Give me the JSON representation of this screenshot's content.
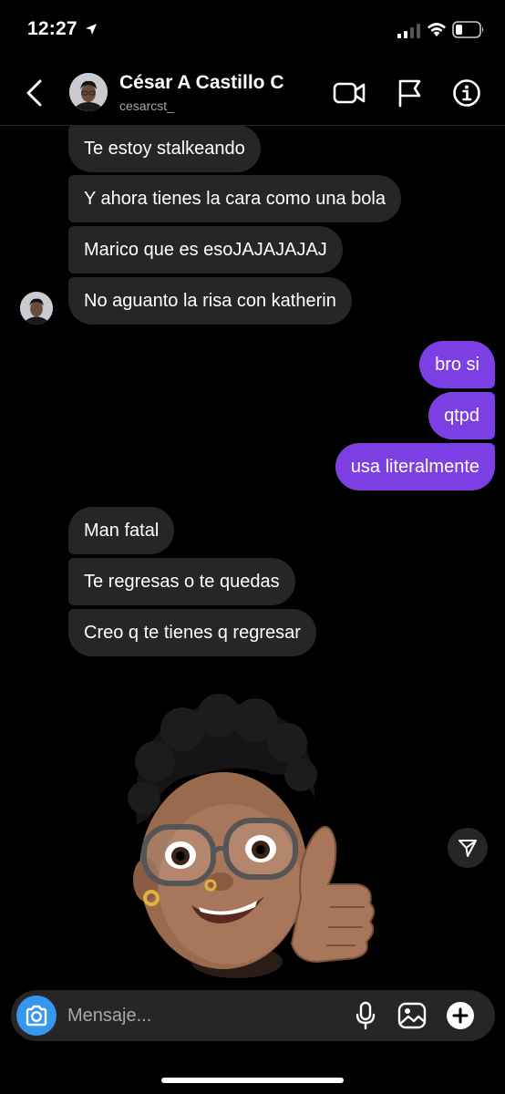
{
  "status_bar": {
    "time": "12:27"
  },
  "header": {
    "contact_name": "César A Castillo C",
    "username": "cesarcst_"
  },
  "messages": [
    {
      "text": "Te estoy stalkeando",
      "direction": "received"
    },
    {
      "text": "Y ahora tienes la cara como una bola",
      "direction": "received"
    },
    {
      "text": "Marico que es esoJAJAJAJAJ",
      "direction": "received"
    },
    {
      "text": "No aguanto la risa con katherin",
      "direction": "received"
    },
    {
      "text": "bro si",
      "direction": "sent"
    },
    {
      "text": "qtpd",
      "direction": "sent"
    },
    {
      "text": "usa literalmente",
      "direction": "sent"
    },
    {
      "text": "Man fatal",
      "direction": "received"
    },
    {
      "text": "Te regresas o te quedas",
      "direction": "received"
    },
    {
      "text": "Creo q te tienes q regresar",
      "direction": "received"
    }
  ],
  "sticker": {
    "kind": "memoji-thumbs-up"
  },
  "composer": {
    "placeholder": "Mensaje..."
  },
  "colors": {
    "background": "#000000",
    "received_bubble": "#262626",
    "sent_bubble": "#7b3fe4",
    "camera_button": "#3797f0",
    "secondary_text": "#a8a8a8"
  }
}
